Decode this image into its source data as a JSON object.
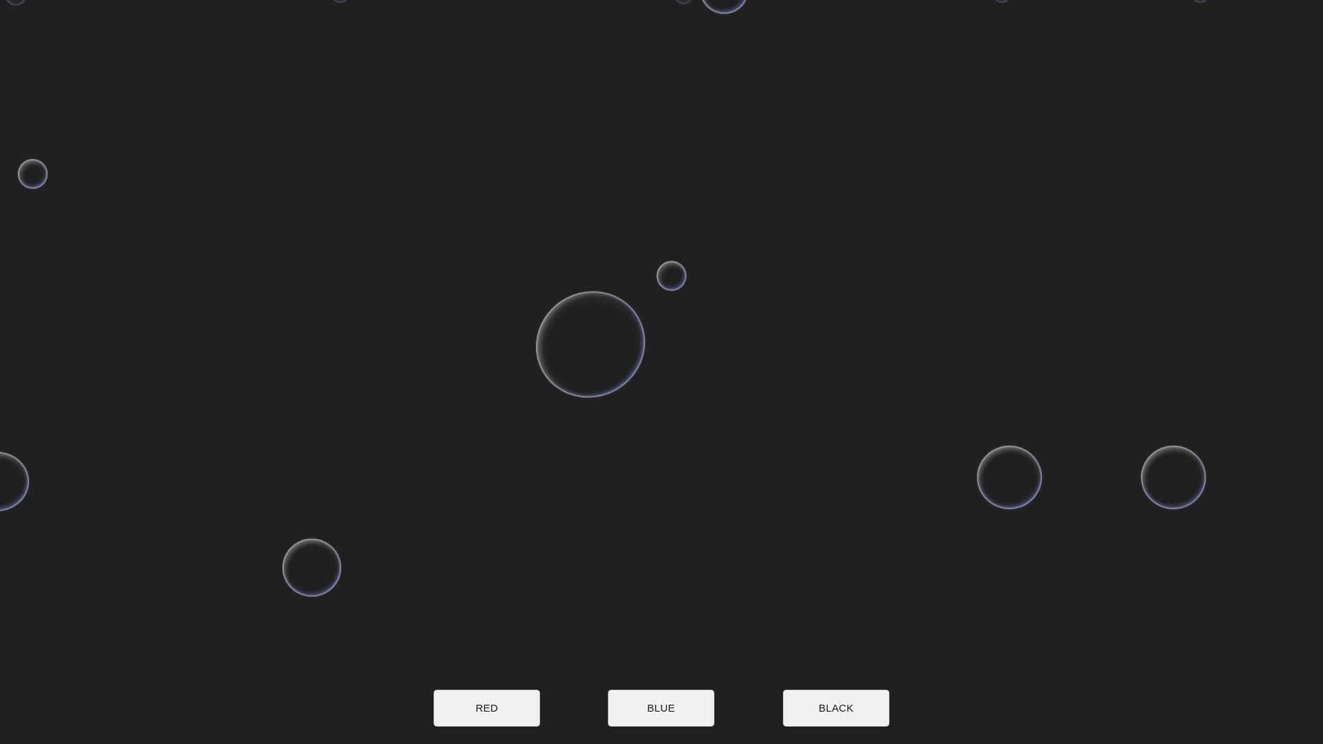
{
  "background_color": "#202020",
  "bubble_rim_color": "#8c94d2",
  "buttons": {
    "red": "RED",
    "blue": "BLUE",
    "black": "BLACK"
  }
}
